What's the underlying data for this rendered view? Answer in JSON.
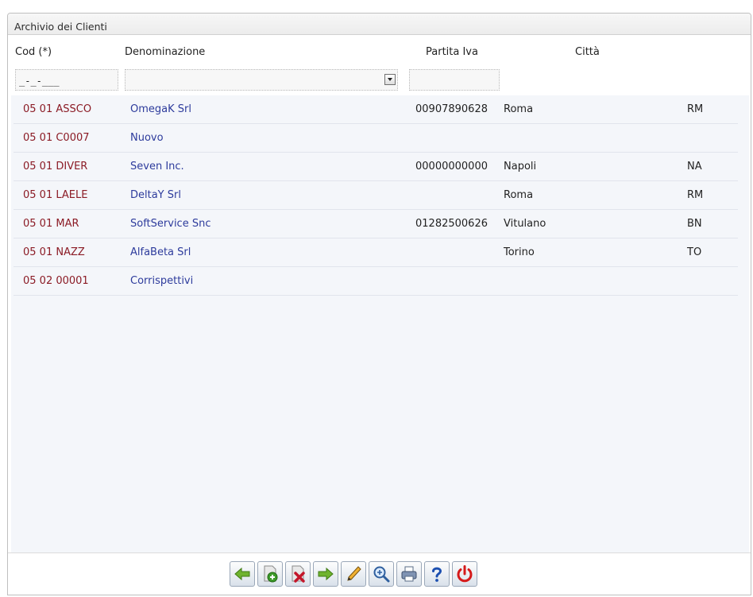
{
  "window": {
    "title": "Archivio dei Clienti"
  },
  "columns": {
    "cod": "Cod (*)",
    "denominazione": "Denominazione",
    "partita_iva": "Partita Iva",
    "citta": "Città"
  },
  "filters": {
    "cod_mask": "_-_-___",
    "denominazione_value": "",
    "partita_iva_value": ""
  },
  "rows": [
    {
      "cod": "05 01 ASSCO",
      "denominazione": "OmegaK Srl",
      "partita_iva": "00907890628",
      "citta": "Roma",
      "provincia": "RM"
    },
    {
      "cod": "05 01 C0007",
      "denominazione": "Nuovo",
      "partita_iva": "",
      "citta": "",
      "provincia": ""
    },
    {
      "cod": "05 01 DIVER",
      "denominazione": "Seven Inc.",
      "partita_iva": "00000000000",
      "citta": "Napoli",
      "provincia": "NA"
    },
    {
      "cod": "05 01 LAELE",
      "denominazione": "DeltaY Srl",
      "partita_iva": "",
      "citta": "Roma",
      "provincia": "RM"
    },
    {
      "cod": "05 01 MAR",
      "denominazione": "SoftService Snc",
      "partita_iva": "01282500626",
      "citta": "Vitulano",
      "provincia": "BN"
    },
    {
      "cod": "05 01 NAZZ",
      "denominazione": "AlfaBeta Srl",
      "partita_iva": "",
      "citta": "Torino",
      "provincia": "TO"
    },
    {
      "cod": "05 02 00001",
      "denominazione": "Corrispettivi",
      "partita_iva": "",
      "citta": "",
      "provincia": ""
    }
  ],
  "toolbar": {
    "buttons": [
      {
        "icon": "arrow-left-icon"
      },
      {
        "icon": "add-record-icon"
      },
      {
        "icon": "delete-record-icon"
      },
      {
        "icon": "arrow-right-icon"
      },
      {
        "icon": "edit-pencil-icon"
      },
      {
        "icon": "zoom-search-icon"
      },
      {
        "icon": "printer-icon"
      },
      {
        "icon": "help-icon"
      },
      {
        "icon": "power-icon"
      }
    ]
  },
  "colors": {
    "code_text": "#8b1b25",
    "name_text": "#2d3b9c",
    "list_background": "#f4f6fa"
  }
}
